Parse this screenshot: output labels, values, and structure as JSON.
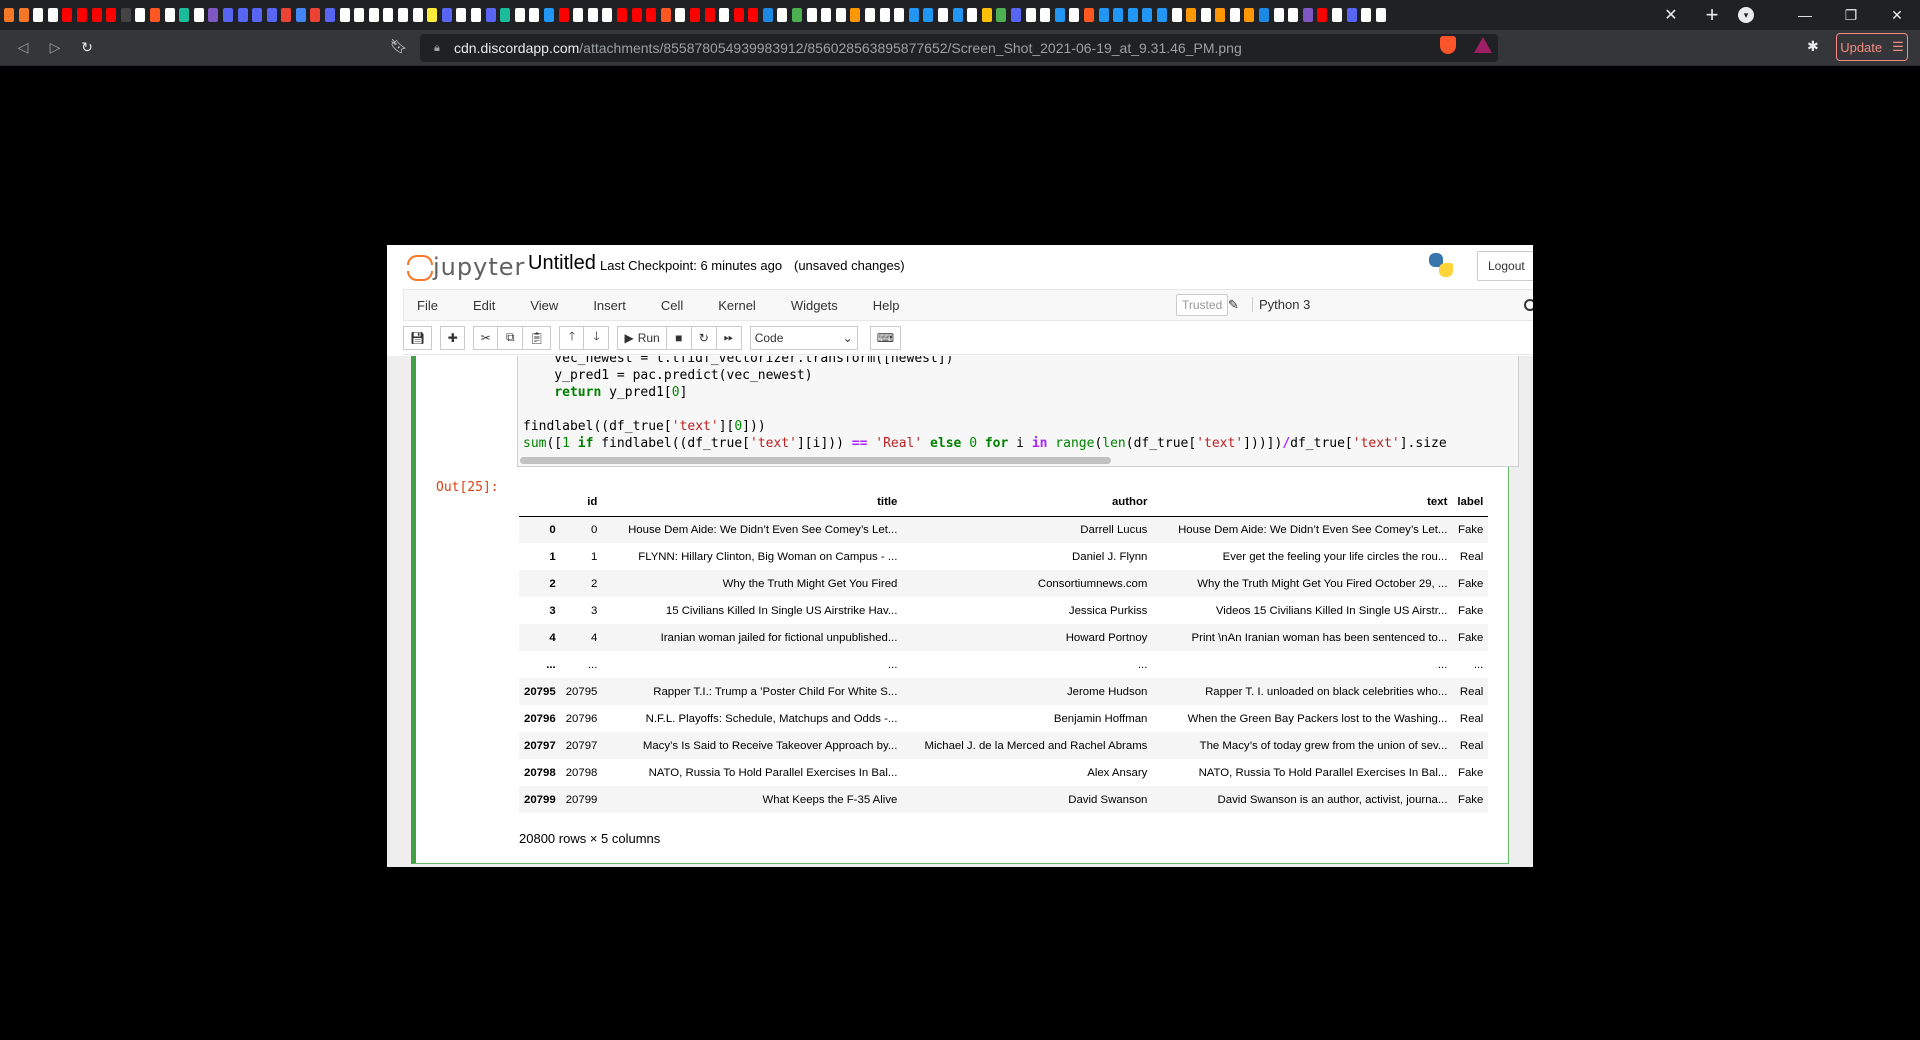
{
  "browser": {
    "tab_colors": [
      "#f37726",
      "#f37726",
      "#ffffff",
      "#ffffff",
      "#ff0000",
      "#ff0000",
      "#ff0000",
      "#ff0000",
      "#444444",
      "#ffffff",
      "#ff5722",
      "#ffffff",
      "#1abc9c",
      "#ffffff",
      "#7e57c2",
      "#5865f2",
      "#5865f2",
      "#5865f2",
      "#5865f2",
      "#ea4335",
      "#4285f4",
      "#ea4335",
      "#5865f2",
      "#ffffff",
      "#ffffff",
      "#ffffff",
      "#ffffff",
      "#ffffff",
      "#ffffff",
      "#ffeb3b",
      "#5865f2",
      "#ffffff",
      "#ffffff",
      "#5865f2",
      "#1abc9c",
      "#ffffff",
      "#ffffff",
      "#2196f3",
      "#ff0000",
      "#ffffff",
      "#ffffff",
      "#ffffff",
      "#ff0000",
      "#ff0000",
      "#ff0000",
      "#ff5722",
      "#ffffff",
      "#ff0000",
      "#ff0000",
      "#ffffff",
      "#ff0000",
      "#ff0000",
      "#1e88e5",
      "#ffffff",
      "#4caf50",
      "#ffffff",
      "#ffffff",
      "#ffffff",
      "#ff9800",
      "#ffffff",
      "#ffffff",
      "#ffffff",
      "#2196f3",
      "#2196f3",
      "#ffffff",
      "#2196f3",
      "#ffffff",
      "#ffc107",
      "#4caf50",
      "#5865f2",
      "#ffffff",
      "#ffffff",
      "#2196f3",
      "#ffffff",
      "#ff5722",
      "#2196f3",
      "#2196f3",
      "#2196f3",
      "#2196f3",
      "#2196f3",
      "#ffffff",
      "#ff9800",
      "#ffffff",
      "#ff9800",
      "#ffffff",
      "#ff9800",
      "#1e88e5",
      "#ffffff",
      "#ffffff",
      "#7e57c2",
      "#ff0000",
      "#ffffff",
      "#5865f2",
      "#ffffff",
      "#ffffff"
    ],
    "close_tab": "✕",
    "new_tab": "+",
    "url_host": "cdn.discordapp.com",
    "url_path": "/attachments/855878054939983912/856028563895877652/Screen_Shot_2021-06-19_at_9.31.46_PM.png",
    "update_label": "Update",
    "menu_glyph": "☰"
  },
  "jupyter": {
    "logo_text": "jupyter",
    "notebook_name": "Untitled",
    "checkpoint": "Last Checkpoint: 6 minutes ago",
    "unsaved": "(unsaved changes)",
    "logout": "Logout",
    "menu": [
      "File",
      "Edit",
      "View",
      "Insert",
      "Cell",
      "Kernel",
      "Widgets",
      "Help"
    ],
    "trusted": "Trusted",
    "kernel": "Python 3",
    "run_label": "Run",
    "cell_type": "Code"
  },
  "cell": {
    "out_prompt": "Out[25]:",
    "df": {
      "columns": [
        "id",
        "title",
        "author",
        "text",
        "label"
      ],
      "rows": [
        [
          "0",
          "0",
          "House Dem Aide: We Didn’t Even See Comey’s Let...",
          "Darrell Lucus",
          "House Dem Aide: We Didn’t Even See Comey’s Let...",
          "Fake"
        ],
        [
          "1",
          "1",
          "FLYNN: Hillary Clinton, Big Woman on Campus - ...",
          "Daniel J. Flynn",
          "Ever get the feeling your life circles the rou...",
          "Real"
        ],
        [
          "2",
          "2",
          "Why the Truth Might Get You Fired",
          "Consortiumnews.com",
          "Why the Truth Might Get You Fired October 29, ...",
          "Fake"
        ],
        [
          "3",
          "3",
          "15 Civilians Killed In Single US Airstrike Hav...",
          "Jessica Purkiss",
          "Videos 15 Civilians Killed In Single US Airstr...",
          "Fake"
        ],
        [
          "4",
          "4",
          "Iranian woman jailed for fictional unpublished...",
          "Howard Portnoy",
          "Print \\nAn Iranian woman has been sentenced to...",
          "Fake"
        ],
        [
          "...",
          "...",
          "...",
          "...",
          "...",
          "..."
        ],
        [
          "20795",
          "20795",
          "Rapper T.I.: Trump a ’Poster Child For White S...",
          "Jerome Hudson",
          "Rapper T. I. unloaded on black celebrities who...",
          "Real"
        ],
        [
          "20796",
          "20796",
          "N.F.L. Playoffs: Schedule, Matchups and Odds -...",
          "Benjamin Hoffman",
          "When the Green Bay Packers lost to the Washing...",
          "Real"
        ],
        [
          "20797",
          "20797",
          "Macy’s Is Said to Receive Takeover Approach by...",
          "Michael J. de la Merced and Rachel Abrams",
          "The Macy’s of today grew from the union of sev...",
          "Real"
        ],
        [
          "20798",
          "20798",
          "NATO, Russia To Hold Parallel Exercises In Bal...",
          "Alex Ansary",
          "NATO, Russia To Hold Parallel Exercises In Bal...",
          "Fake"
        ],
        [
          "20799",
          "20799",
          "What Keeps the F-35 Alive",
          "David Swanson",
          "David Swanson is an author, activist, journa...",
          "Fake"
        ]
      ],
      "shape": "20800 rows × 5 columns"
    }
  }
}
